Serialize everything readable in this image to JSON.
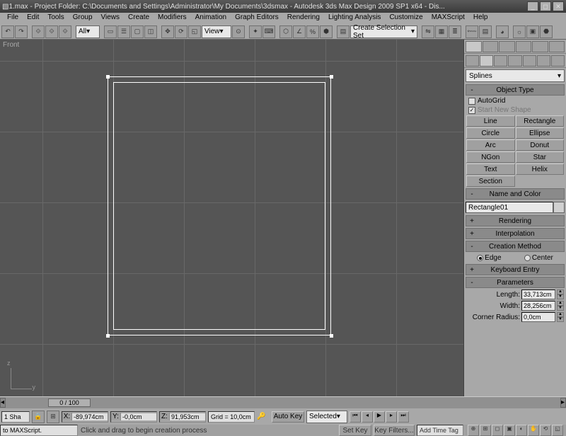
{
  "title": "1.max   - Project Folder: C:\\Documents and Settings\\Administrator\\My Documents\\3dsmax   - Autodesk 3ds Max Design 2009 SP1  x64     - Dis...",
  "menu": [
    "File",
    "Edit",
    "Tools",
    "Group",
    "Views",
    "Create",
    "Modifiers",
    "Animation",
    "Graph Editors",
    "Rendering",
    "Lighting Analysis",
    "Customize",
    "MAXScript",
    "Help"
  ],
  "toolbar": {
    "all": "All",
    "view": "View",
    "selset": "Create Selection Set"
  },
  "viewport": {
    "label": "Front"
  },
  "panel": {
    "dropdown": "Splines",
    "object_type": {
      "title": "Object Type",
      "autogrid": "AutoGrid",
      "startnew": "Start New Shape",
      "buttons": [
        "Line",
        "Rectangle",
        "Circle",
        "Ellipse",
        "Arc",
        "Donut",
        "NGon",
        "Star",
        "Text",
        "Helix",
        "Section"
      ]
    },
    "name_color": {
      "title": "Name and Color",
      "name": "Rectangle01"
    },
    "rendering": "Rendering",
    "interpolation": "Interpolation",
    "creation": {
      "title": "Creation Method",
      "edge": "Edge",
      "center": "Center"
    },
    "keyboard": "Keyboard Entry",
    "parameters": {
      "title": "Parameters",
      "length_label": "Length:",
      "length": "33,713cm",
      "width_label": "Width:",
      "width": "28,256cm",
      "corner_label": "Corner Radius:",
      "corner": "0,0cm"
    }
  },
  "timeline": {
    "pos": "0 / 100"
  },
  "status": {
    "selection": "1 Sha",
    "x": "-89,974cm",
    "y": "-0,0cm",
    "z": "91,953cm",
    "grid": "Grid = 10,0cm",
    "autokey": "Auto Key",
    "setkey": "Set Key",
    "selected": "Selected",
    "keyfilters": "Key Filters...",
    "addtag": "Add Time Tag"
  },
  "prompt": {
    "script": "to MAXScript.",
    "msg": "Click and drag to begin creation process"
  }
}
